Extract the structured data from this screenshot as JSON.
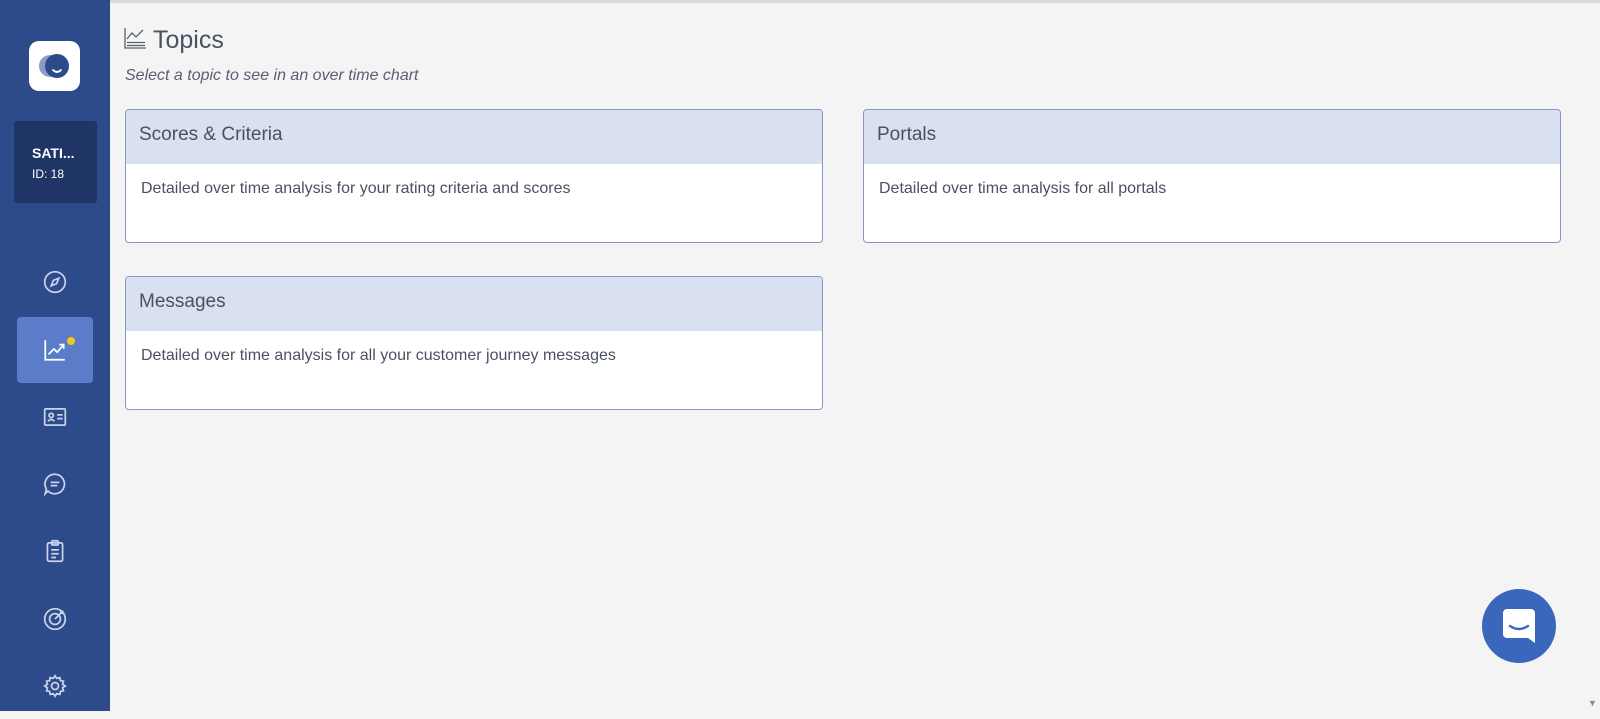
{
  "sidebar": {
    "account": {
      "name": "SATI...",
      "id": "ID: 18"
    },
    "nav": [
      {
        "icon": "compass-icon",
        "active": false
      },
      {
        "icon": "trend-chart-icon",
        "active": true,
        "badge_color": "#f5c518"
      },
      {
        "icon": "contact-card-icon",
        "active": false
      },
      {
        "icon": "chat-bubble-icon",
        "active": false
      },
      {
        "icon": "clipboard-icon",
        "active": false
      },
      {
        "icon": "target-icon",
        "active": false
      },
      {
        "icon": "gear-icon",
        "active": false
      }
    ]
  },
  "header": {
    "icon": "line-chart-icon",
    "title": "Topics",
    "subtitle": "Select a topic to see in an over time chart"
  },
  "topics": [
    {
      "title": "Scores & Criteria",
      "description": "Detailed over time analysis for your rating criteria and scores"
    },
    {
      "title": "Portals",
      "description": "Detailed over time analysis for all portals"
    },
    {
      "title": "Messages",
      "description": "Detailed over time analysis for all your customer journey messages"
    }
  ],
  "colors": {
    "sidebar": "#2d4a8a",
    "accent": "#5b7dc9",
    "card_header": "#d9e0ef",
    "badge": "#f5c518",
    "chat_button": "#3a66bb"
  }
}
